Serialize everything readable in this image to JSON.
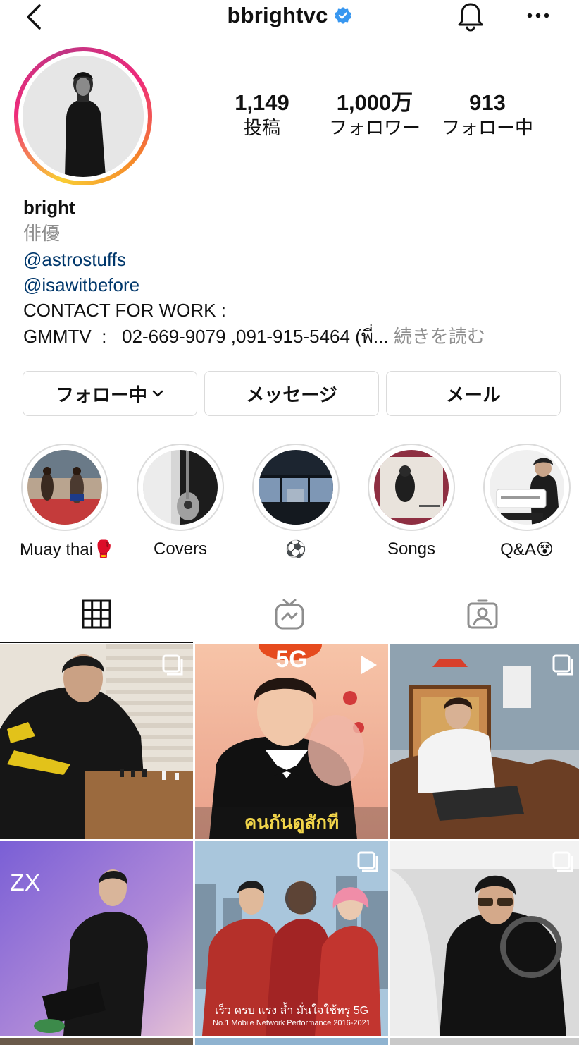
{
  "header": {
    "username": "bbrightvc"
  },
  "profile": {
    "stats": [
      {
        "value": "1,149",
        "label": "投稿"
      },
      {
        "value": "1,000万",
        "label": "フォロワー"
      },
      {
        "value": "913",
        "label": "フォロー中"
      }
    ],
    "name": "bright",
    "category": "俳優",
    "links": [
      "@astrostuffs",
      "@isawitbefore"
    ],
    "bio_line1": "CONTACT FOR WORK :",
    "bio_line2": "GMMTV  :   02-669-9079 ,091-915-5464 (พี่...",
    "read_more": "続きを読む"
  },
  "buttons": {
    "following": "フォロー中",
    "message": "メッセージ",
    "email": "メール"
  },
  "highlights": [
    {
      "label": "Muay thai🥊"
    },
    {
      "label": "Covers"
    },
    {
      "label": "⚽"
    },
    {
      "label": "Songs"
    },
    {
      "label": "Q&A😵"
    }
  ],
  "posts": [
    {
      "type": "carousel"
    },
    {
      "type": "video",
      "caption_top": "5G",
      "caption_bottom": "คนกันดูสักที"
    },
    {
      "type": "carousel"
    },
    {
      "type": "image",
      "caption_top": "ZX"
    },
    {
      "type": "carousel",
      "caption_bottom": "เร็ว ครบ แรง ล้ำ มั่นใจใช้ทรู 5G",
      "caption_small": "No.1 Mobile Network Performance 2016-2021"
    },
    {
      "type": "carousel"
    }
  ],
  "colors": {
    "link": "#00376b",
    "muted": "#8e8e8e",
    "verified": "#3897f0",
    "border": "#dbdbdb"
  }
}
